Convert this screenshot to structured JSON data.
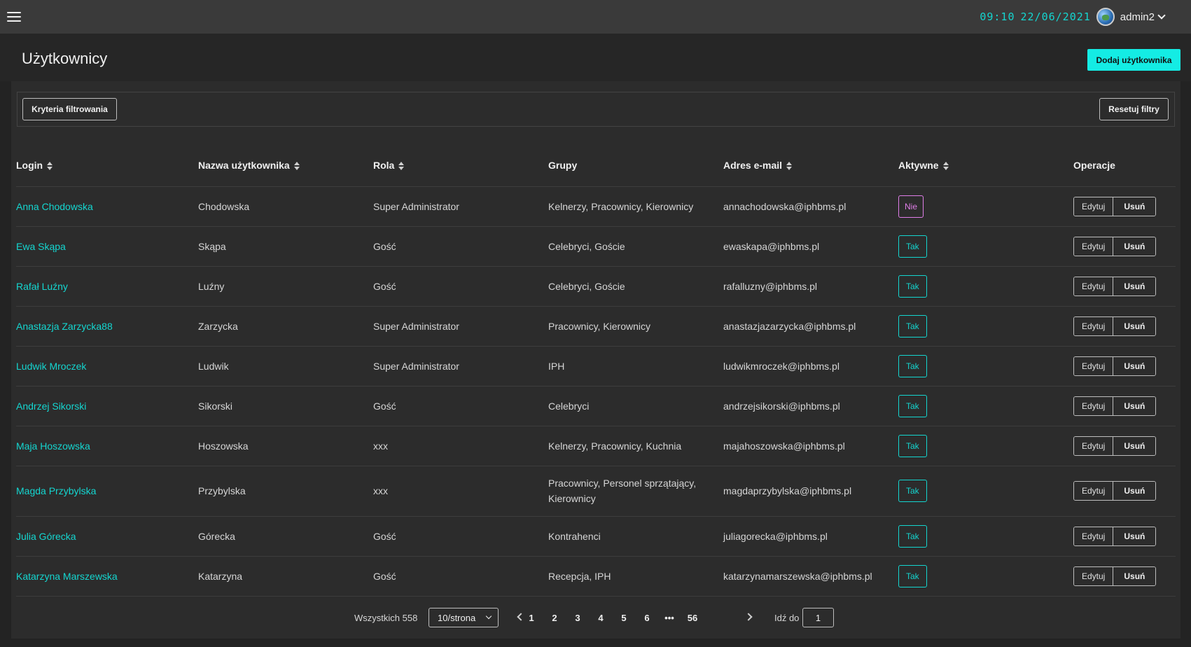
{
  "topbar": {
    "time": "09:10",
    "date": "22/06/2021",
    "username": "admin2",
    "icons": [
      "menu-icon",
      "globe-avatar",
      "chevron-down-icon"
    ]
  },
  "header": {
    "title": "Użytkownicy",
    "add_button": "Dodaj użytkownika",
    "accent_color": "#14ece4"
  },
  "filters": {
    "criteria_button": "Kryteria filtrowania",
    "reset_button": "Resetuj filtry"
  },
  "table": {
    "columns": [
      "Login",
      "Nazwa użytkownika",
      "Rola",
      "Grupy",
      "Adres e-mail",
      "Aktywne",
      "Operacje"
    ],
    "sortable": [
      true,
      true,
      true,
      false,
      true,
      true,
      false
    ],
    "rows": [
      {
        "login": "Anna Chodowska",
        "name": "Chodowska",
        "role": "Super Administrator",
        "groups": "Kelnerzy, Pracownicy, Kierownicy",
        "email": "annachodowska@iphbms.pl",
        "active": "Nie"
      },
      {
        "login": "Ewa Skąpa",
        "name": "Skąpa",
        "role": "Gość",
        "groups": "Celebryci, Goście",
        "email": "ewaskapa@iphbms.pl",
        "active": "Tak"
      },
      {
        "login": "Rafał Luźny",
        "name": "Luźny",
        "role": "Gość",
        "groups": "Celebryci, Goście",
        "email": "rafalluzny@iphbms.pl",
        "active": "Tak"
      },
      {
        "login": "Anastazja Zarzycka88",
        "name": "Zarzycka",
        "role": "Super Administrator",
        "groups": "Pracownicy, Kierownicy",
        "email": "anastazjazarzycka@iphbms.pl",
        "active": "Tak"
      },
      {
        "login": "Ludwik Mroczek",
        "name": "Ludwik",
        "role": "Super Administrator",
        "groups": "IPH",
        "email": "ludwikmroczek@iphbms.pl",
        "active": "Tak"
      },
      {
        "login": "Andrzej Sikorski",
        "name": "Sikorski",
        "role": "Gość",
        "groups": "Celebryci",
        "email": "andrzejsikorski@iphbms.pl",
        "active": "Tak"
      },
      {
        "login": "Maja Hoszowska",
        "name": "Hoszowska",
        "role": "xxx",
        "groups": "Kelnerzy, Pracownicy, Kuchnia",
        "email": "majahoszowska@iphbms.pl",
        "active": "Tak"
      },
      {
        "login": "Magda Przybylska",
        "name": "Przybylska",
        "role": "xxx",
        "groups": "Pracownicy, Personel sprzątający, Kierownicy",
        "email": "magdaprzybylska@iphbms.pl",
        "active": "Tak"
      },
      {
        "login": "Julia Górecka",
        "name": "Górecka",
        "role": "Gość",
        "groups": "Kontrahenci",
        "email": "juliagorecka@iphbms.pl",
        "active": "Tak"
      },
      {
        "login": "Katarzyna Marszewska",
        "name": "Katarzyna",
        "role": "Gość",
        "groups": "Recepcja, IPH",
        "email": "katarzynamarszewska@iphbms.pl",
        "active": "Tak"
      }
    ],
    "edit_label": "Edytuj",
    "delete_label": "Usuń"
  },
  "pagination": {
    "total": "Wszystkich 558",
    "page_size": "10/strona",
    "pages": [
      "1",
      "2",
      "3",
      "4",
      "5",
      "6",
      "•••",
      "56"
    ],
    "goto_label": "Idź do",
    "goto_value": "1"
  }
}
